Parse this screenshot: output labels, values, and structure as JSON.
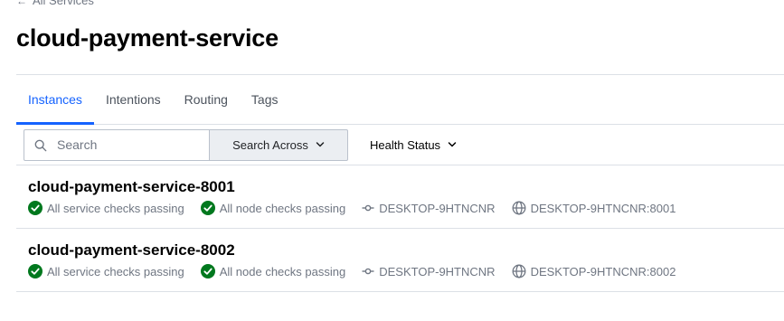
{
  "breadcrumb": {
    "label": "All Services"
  },
  "page": {
    "title": "cloud-payment-service"
  },
  "tabs": [
    {
      "label": "Instances",
      "active": true
    },
    {
      "label": "Intentions",
      "active": false
    },
    {
      "label": "Routing",
      "active": false
    },
    {
      "label": "Tags",
      "active": false
    }
  ],
  "toolbar": {
    "search_placeholder": "Search",
    "search_across_label": "Search Across",
    "health_status_label": "Health Status"
  },
  "colors": {
    "accent": "#1563ff",
    "passing": "#00781e",
    "muted_text": "#6f7682"
  },
  "instances": [
    {
      "name": "cloud-payment-service-8001",
      "service_checks": "All service checks passing",
      "node_checks": "All node checks passing",
      "node": "DESKTOP-9HTNCNR",
      "address": "DESKTOP-9HTNCNR:8001"
    },
    {
      "name": "cloud-payment-service-8002",
      "service_checks": "All service checks passing",
      "node_checks": "All node checks passing",
      "node": "DESKTOP-9HTNCNR",
      "address": "DESKTOP-9HTNCNR:8002"
    }
  ]
}
